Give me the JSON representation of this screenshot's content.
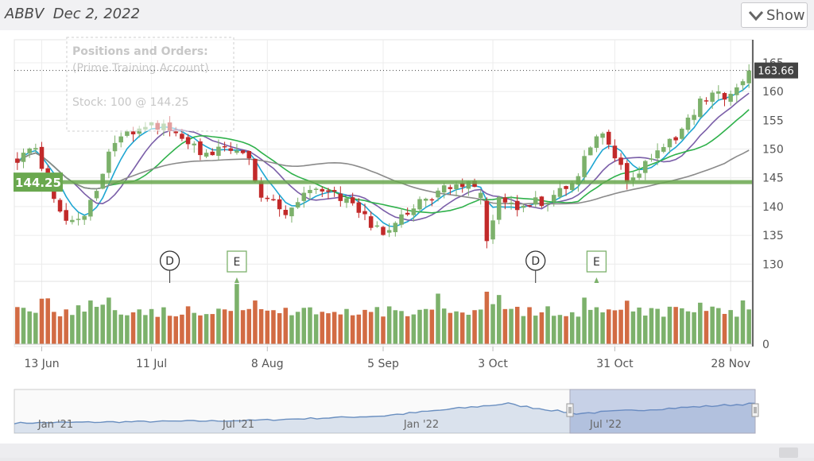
{
  "header": {
    "ticker": "ABBV",
    "date": "Dec 2, 2022",
    "show_label": "Show"
  },
  "overlay": {
    "title": "Positions and Orders:",
    "account": "(Prime Training Account)",
    "stock": "Stock: 100 @ 144.25"
  },
  "colors": {
    "up": "#7cb16b",
    "down": "#c22a2a",
    "volume_down": "#d26b43",
    "sma_fast": "#1ea6d2",
    "sma_mid": "#7a5ea8",
    "sma_slow": "#2fb14b",
    "sma_long": "#8a8a8a",
    "position_line": "#6aa84f",
    "navigator": "#6a8fc0"
  },
  "chart_data": {
    "type": "candlestick",
    "y_ticks": [
      "130",
      "135",
      "140",
      "145",
      "150",
      "155",
      "160",
      "165"
    ],
    "ylim": [
      127,
      169
    ],
    "x_labels": [
      {
        "label": "13 Jun",
        "index": 4
      },
      {
        "label": "11 Jul",
        "index": 22
      },
      {
        "label": "8 Aug",
        "index": 41
      },
      {
        "label": "5 Sep",
        "index": 60
      },
      {
        "label": "3 Oct",
        "index": 78
      },
      {
        "label": "31 Oct",
        "index": 98
      },
      {
        "label": "28 Nov",
        "index": 117
      }
    ],
    "volume_zero_label": "0",
    "last_price": "163.66",
    "position_price": "144.25",
    "events": [
      {
        "label": "D",
        "index": 25,
        "kind": "dividend"
      },
      {
        "label": "E",
        "index": 36,
        "kind": "earnings"
      },
      {
        "label": "D",
        "index": 85,
        "kind": "dividend"
      },
      {
        "label": "E",
        "index": 95,
        "kind": "earnings"
      }
    ],
    "navigator": {
      "labels": [
        "Jan '21",
        "Jul '21",
        "Jan '22",
        "Jul '22"
      ]
    }
  }
}
